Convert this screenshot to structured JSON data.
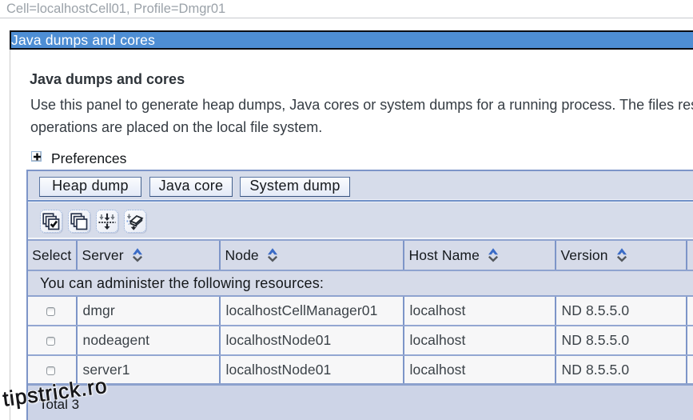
{
  "breadcrumb": "Cell=localhostCell01, Profile=Dmgr01",
  "title_bar": "Java dumps and cores",
  "page": {
    "heading": "Java dumps and cores",
    "description_line1": "Use this panel to generate heap dumps, Java cores or system dumps for a running process. The files resulting from these",
    "description_line2": "operations are placed on the local file system.",
    "preferences_label": "Preferences"
  },
  "toolbar": {
    "buttons": [
      {
        "label": "Heap dump"
      },
      {
        "label": "Java core"
      },
      {
        "label": "System dump"
      }
    ],
    "icons": [
      {
        "name": "select-all-icon"
      },
      {
        "name": "deselect-all-icon"
      },
      {
        "name": "show-filter-icon"
      },
      {
        "name": "clear-filter-icon"
      }
    ]
  },
  "table": {
    "columns": [
      {
        "label": "Select",
        "sortable": false
      },
      {
        "label": "Server",
        "sortable": true
      },
      {
        "label": "Node",
        "sortable": true
      },
      {
        "label": "Host Name",
        "sortable": true
      },
      {
        "label": "Version",
        "sortable": true
      }
    ],
    "caption": "You can administer the following resources:",
    "rows": [
      {
        "server": "dmgr",
        "node": "localhostCellManager01",
        "host": "localhost",
        "version": "ND 8.5.5.0",
        "selected": false
      },
      {
        "server": "nodeagent",
        "node": "localhostNode01",
        "host": "localhost",
        "version": "ND 8.5.5.0",
        "selected": false
      },
      {
        "server": "server1",
        "node": "localhostNode01",
        "host": "localhost",
        "version": "ND 8.5.5.0",
        "selected": false
      }
    ],
    "footer": "Total 3"
  },
  "watermark": "tipstrick.ro",
  "colors": {
    "title_bar_blue": "#4e8ed4",
    "table_border_blue": "#7d95c8",
    "panel_lavender": "#d6dbe9",
    "sort_up_blue": "#3a6bc6"
  }
}
